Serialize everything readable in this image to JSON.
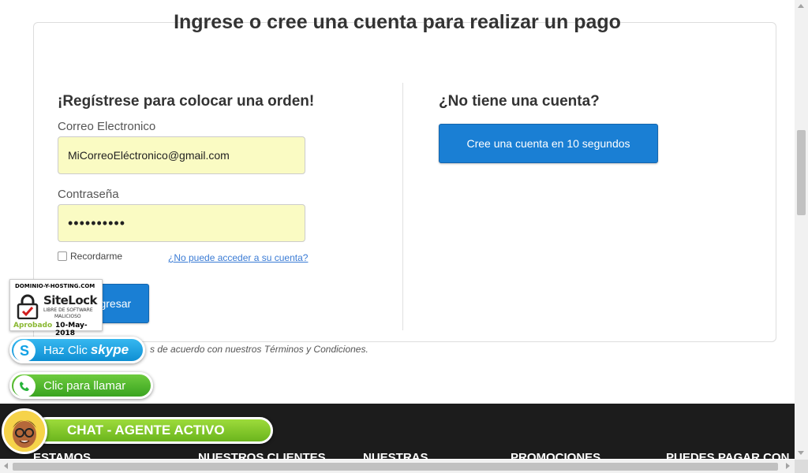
{
  "header": {
    "title": "Ingrese o cree una cuenta para realizar un pago"
  },
  "login": {
    "title": "¡Regístrese para colocar una orden!",
    "email_label": "Correo Electronico",
    "email_value": "MiCorreoEléctronico@gmail.com",
    "password_label": "Contraseña",
    "password_value": "••••••••••",
    "remember_label": "Recordarme",
    "forgot_link": "¿No puede acceder a su cuenta?",
    "submit_label": "Ingresar",
    "terms_text": "s de acuerdo con nuestros Términos y Condiciones."
  },
  "signup": {
    "title": "¿No tiene una cuenta?",
    "button_label": "Cree una cuenta en 10 segundos"
  },
  "sitelock": {
    "domain": "DOMINIO-Y-HOSTING.COM",
    "brand": "SiteLock",
    "line1": "LIBRE DE SOFTWARE",
    "line2": "MALICIOSO",
    "status": "Aprobado",
    "date": "10-May-2018"
  },
  "contact": {
    "skype_label": "Haz Clic",
    "skype_brand": "skype",
    "call_label": "Clic para llamar",
    "chat_label": "CHAT - AGENTE ACTIVO"
  },
  "footer": {
    "items": [
      "ESTAMOS",
      "NUESTROS CLIENTES",
      "NUESTRAS",
      "PROMOCIONES",
      "PUEDES PAGAR CON"
    ]
  },
  "colors": {
    "primary_button": "#1a7fd4",
    "autofill": "#fafbc3",
    "footer_bg": "#1c1c1c",
    "chat_green": "#7cc529",
    "skype_blue": "#12a1e5",
    "whatsapp_green": "#3fae29"
  }
}
